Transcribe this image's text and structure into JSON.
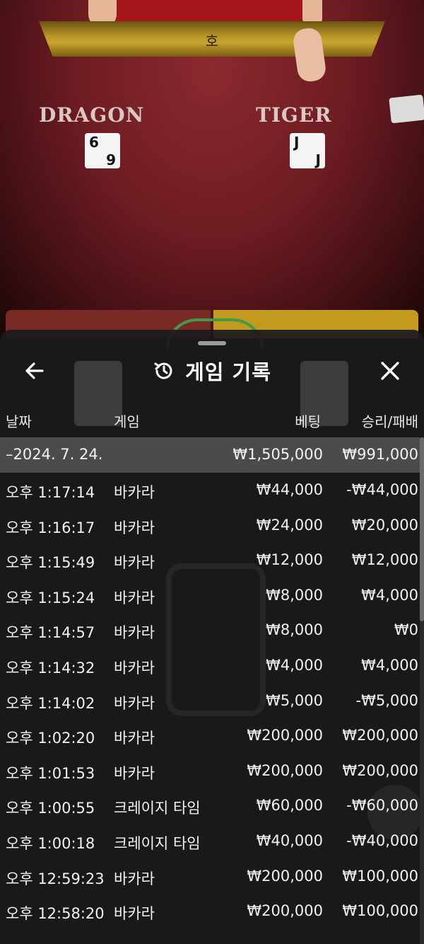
{
  "table": {
    "banner_label": "호",
    "dragon_label": "DRAGON",
    "tiger_label": "TIGER",
    "dragon_card": {
      "rank_top": "6",
      "rank_bottom": "9",
      "suit": "♣"
    },
    "tiger_card": {
      "rank_top": "J",
      "rank_bottom": "J",
      "suit": "♠"
    }
  },
  "sheet": {
    "title": "게임 기록",
    "columns": {
      "date": "날짜",
      "game": "게임",
      "bet": "베팅",
      "result": "승리/패배"
    },
    "day": {
      "date": "–2024. 7. 24.",
      "bet": "₩1,505,000",
      "result": "₩991,000"
    },
    "rows": [
      {
        "time": "오후 1:17:14",
        "game": "바카라",
        "bet": "₩44,000",
        "result": "-₩44,000"
      },
      {
        "time": "오후 1:16:17",
        "game": "바카라",
        "bet": "₩24,000",
        "result": "₩20,000"
      },
      {
        "time": "오후 1:15:49",
        "game": "바카라",
        "bet": "₩12,000",
        "result": "₩12,000"
      },
      {
        "time": "오후 1:15:24",
        "game": "바카라",
        "bet": "₩8,000",
        "result": "₩4,000"
      },
      {
        "time": "오후 1:14:57",
        "game": "바카라",
        "bet": "₩8,000",
        "result": "₩0"
      },
      {
        "time": "오후 1:14:32",
        "game": "바카라",
        "bet": "₩4,000",
        "result": "₩4,000"
      },
      {
        "time": "오후 1:14:02",
        "game": "바카라",
        "bet": "₩5,000",
        "result": "-₩5,000"
      },
      {
        "time": "오후 1:02:20",
        "game": "바카라",
        "bet": "₩200,000",
        "result": "₩200,000"
      },
      {
        "time": "오후 1:01:53",
        "game": "바카라",
        "bet": "₩200,000",
        "result": "₩200,000"
      },
      {
        "time": "오후 1:00:55",
        "game": "크레이지 타임",
        "bet": "₩60,000",
        "result": "-₩60,000"
      },
      {
        "time": "오후 1:00:18",
        "game": "크레이지 타임",
        "bet": "₩40,000",
        "result": "-₩40,000"
      },
      {
        "time": "오후 12:59:23",
        "game": "바카라",
        "bet": "₩200,000",
        "result": "₩100,000"
      },
      {
        "time": "오후 12:58:20",
        "game": "바카라",
        "bet": "₩200,000",
        "result": "₩100,000"
      }
    ]
  },
  "colors": {
    "sheet_bg": "#1a1a1c",
    "day_row_bg": "#4b4b4d",
    "table_felt": "#6e1c22",
    "banner_gold": "#c9a52f"
  },
  "icons": {
    "back": "arrow-left-icon",
    "history": "history-icon",
    "close": "close-icon"
  }
}
